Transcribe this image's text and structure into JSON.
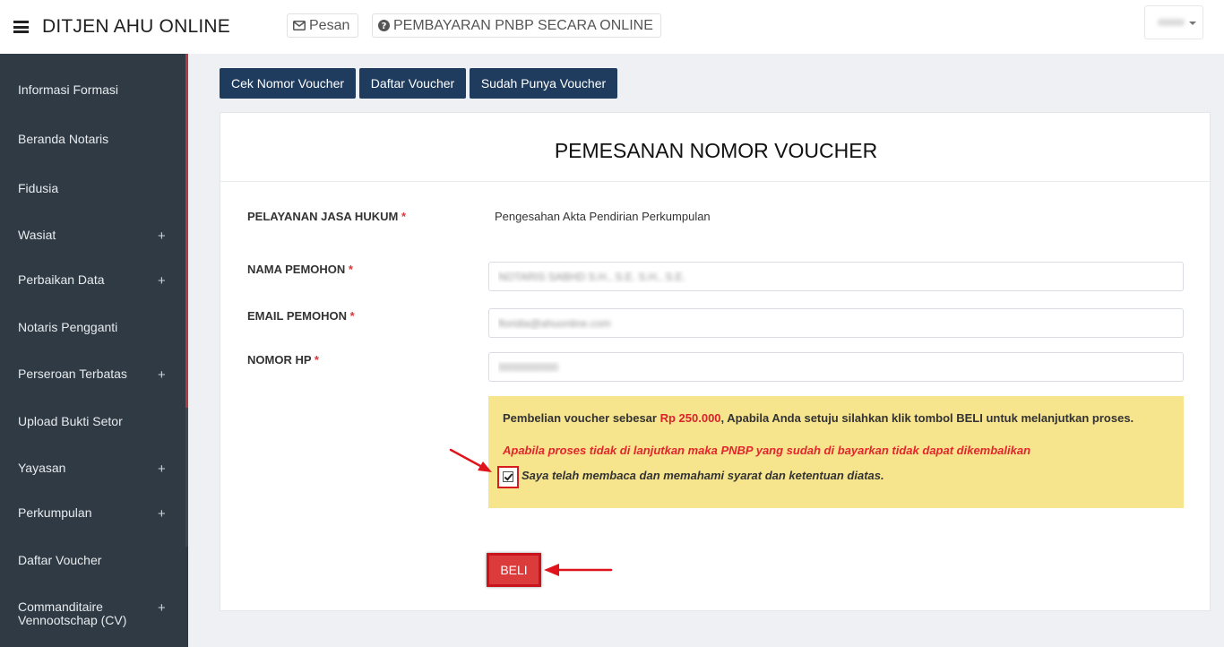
{
  "header": {
    "brand": "DITJEN AHU ONLINE",
    "pesan_label": "Pesan",
    "pnbp_label": "PEMBAYARAN PNBP SECARA ONLINE"
  },
  "sidebar": {
    "items": [
      {
        "label": "Informasi Formasi",
        "plus": ""
      },
      {
        "label": "Beranda Notaris",
        "plus": ""
      },
      {
        "label": "Fidusia",
        "plus": ""
      },
      {
        "label": "Wasiat",
        "plus": "+"
      },
      {
        "label": "Perbaikan Data",
        "plus": "+"
      },
      {
        "label": "Notaris Pengganti",
        "plus": ""
      },
      {
        "label": "Perseroan Terbatas",
        "plus": "+"
      },
      {
        "label": "Upload Bukti Setor",
        "plus": ""
      },
      {
        "label": "Yayasan",
        "plus": "+"
      },
      {
        "label": "Perkumpulan",
        "plus": "+"
      },
      {
        "label": "Daftar Voucher",
        "plus": ""
      },
      {
        "label": "Commanditaire Vennootschap (CV)",
        "plus": "+"
      }
    ]
  },
  "tabs": {
    "cek": "Cek Nomor Voucher",
    "daftar": "Daftar Voucher",
    "sudah": "Sudah Punya Voucher"
  },
  "form": {
    "title": "PEMESANAN NOMOR VOUCHER",
    "required_mark": "*",
    "pelayanan_label": "PELAYANAN JASA HUKUM",
    "pelayanan_value": "Pengesahan Akta Pendirian Perkumpulan",
    "nama_label": "NAMA PEMOHON",
    "nama_value": "NOTARIS SABHD S.H., S.E. S.H., S.E.",
    "email_label": "EMAIL PEMOHON",
    "email_value": "floridia@ahuonline.com",
    "hp_label": "NOMOR HP",
    "hp_value": "0000000000"
  },
  "notice": {
    "line1_before": "Pembelian voucher sebesar ",
    "amount": "Rp 250.000",
    "line1_after": ", Apabila Anda setuju silahkan klik tombol BELI untuk melanjutkan proses.",
    "warning": "Apabila proses tidak di lanjutkan maka PNBP yang sudah di bayarkan tidak dapat dikembalikan",
    "agree_text": "Saya telah membaca dan memahami syarat dan ketentuan diatas."
  },
  "actions": {
    "beli_label": "BELI"
  },
  "colors": {
    "sidebar_bg": "#2f3a44",
    "sidebar_accent": "#b23b43",
    "tab_button": "#1f3c5e",
    "notice_bg": "#f6e58d",
    "beli_button": "#dc3b3b",
    "highlight_red": "#d61c20"
  }
}
